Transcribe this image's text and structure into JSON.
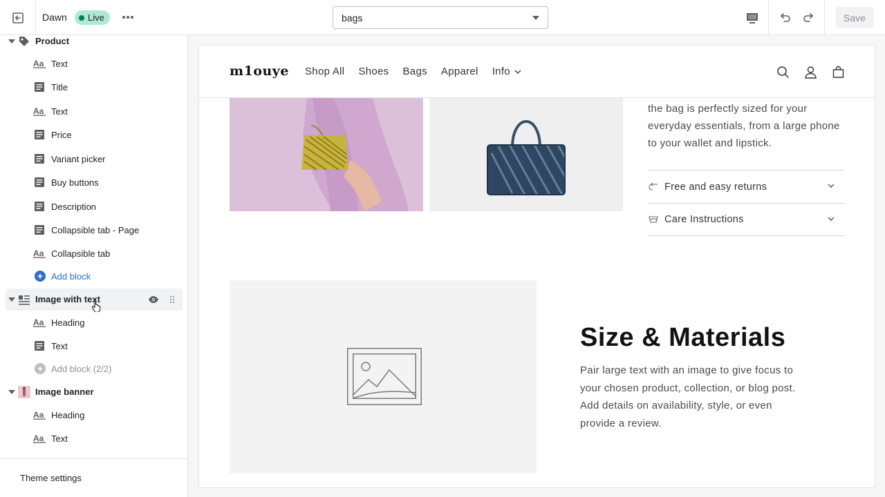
{
  "topbar": {
    "theme_name": "Dawn",
    "live_label": "Live",
    "template_value": "bags",
    "save_label": "Save"
  },
  "sidebar": {
    "sections": [
      {
        "label": "Product",
        "blocks": [
          "Text",
          "Title",
          "Text",
          "Price",
          "Variant picker",
          "Buy buttons",
          "Description",
          "Collapsible tab - Page",
          "Collapsible tab"
        ],
        "add_label": "Add block"
      },
      {
        "label": "Image with text",
        "blocks": [
          "Heading",
          "Text"
        ],
        "add_label": "Add block (2/2)"
      },
      {
        "label": "Image banner",
        "blocks": [
          "Heading",
          "Text"
        ]
      }
    ],
    "theme_settings_label": "Theme settings"
  },
  "store": {
    "logo": "m1ouye",
    "nav": [
      "Shop All",
      "Shoes",
      "Bags",
      "Apparel",
      "Info"
    ],
    "product_description": "the bag is perfectly sized for your everyday essentials, from a large phone to your wallet and lipstick.",
    "accordions": [
      "Free and easy returns",
      "Care Instructions"
    ],
    "image_with_text": {
      "heading": "Size & Materials",
      "text": "Pair large text with an image to give focus to your chosen product, collection, or blog post. Add details on availability, style, or even provide a review."
    }
  },
  "colors": {
    "live_badge": "#aee9d1",
    "live_dot": "#008060",
    "link_blue": "#2c6ecb",
    "photo_pink": "#ddbfdb",
    "bag_yellow": "#c8b43c",
    "bag_navy": "#2f4560"
  }
}
